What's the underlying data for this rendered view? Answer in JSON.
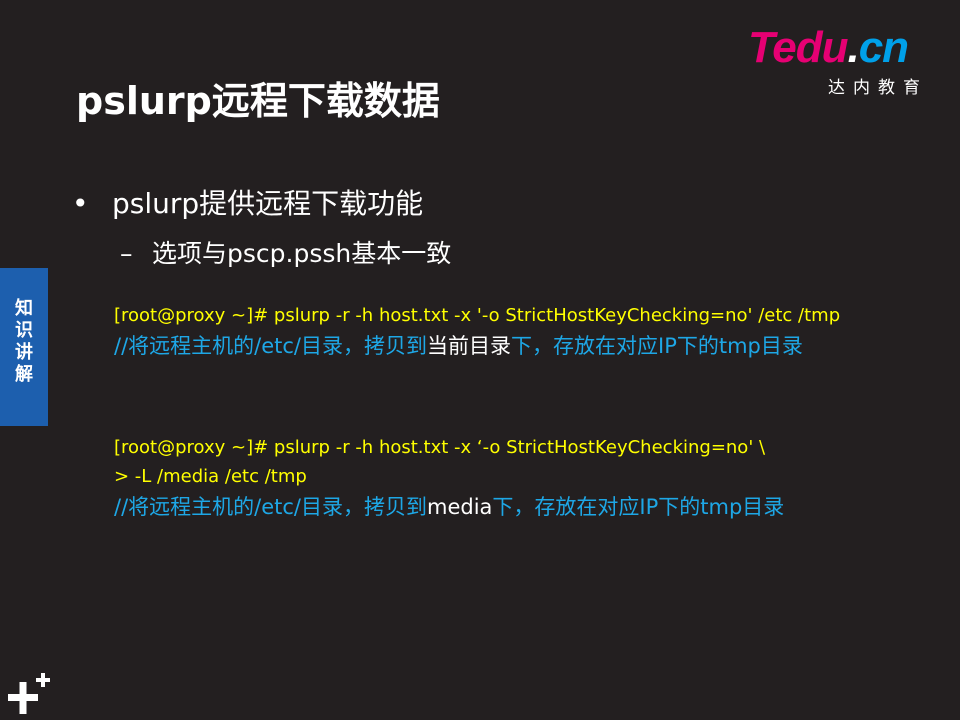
{
  "title": "pslurp远程下载数据",
  "logo": {
    "brand_main": "Tedu",
    "brand_dot": ".",
    "brand_cn": "cn",
    "subtitle": "达内教育"
  },
  "side_tab": "知识讲解",
  "bullet": "pslurp提供远程下载功能",
  "sub_bullet": "选项与pscp.pssh基本一致",
  "example1": {
    "command": "[root@proxy ~]# pslurp -r -h host.txt -x '-o StrictHostKeyChecking=no' /etc /tmp",
    "comment_a": "//将远程主机的/etc/目录，拷贝到",
    "comment_b": "当前目录",
    "comment_c": "下，存放在对应IP下的tmp目录"
  },
  "example2": {
    "command": "[root@proxy ~]# pslurp -r -h host.txt -x ‘-o StrictHostKeyChecking=no'  \\",
    "command2": ">  -L  /media   /etc   /tmp",
    "comment_a": "//将远程主机的/etc/目录，拷贝到",
    "comment_b": "media",
    "comment_c": "下，存放在对应IP下的tmp目录"
  },
  "colors": {
    "background": "#231f20",
    "command": "#ffff00",
    "comment": "#1ea7e6",
    "side_tab": "#1d5fae",
    "brand": "#e60073"
  },
  "icons": {
    "corner": "plus-plus-icon"
  }
}
